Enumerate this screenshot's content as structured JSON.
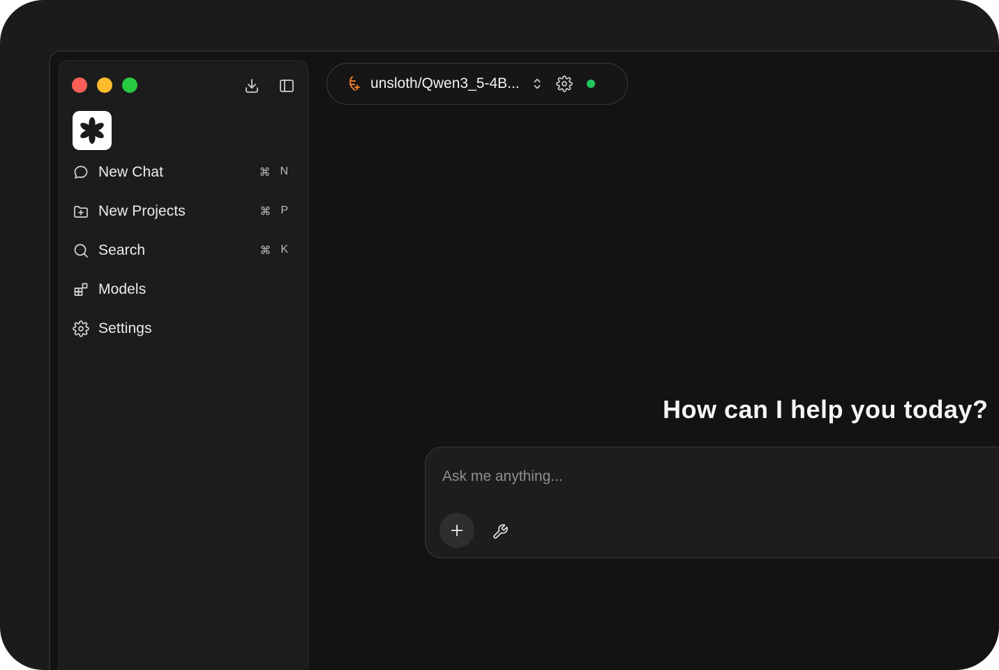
{
  "window": {
    "traffic_lights": [
      "close",
      "minimize",
      "zoom"
    ],
    "colors": {
      "close": "#ff5f57",
      "minimize": "#febc2e",
      "zoom": "#28c840"
    }
  },
  "sidebar": {
    "toolbar_icons": [
      "download-icon",
      "sidebar-toggle-icon"
    ],
    "logo_icon": "asterisk-logo",
    "items": [
      {
        "label": "New Chat",
        "icon": "chat-bubble-icon",
        "shortcut_mod": "⌘",
        "shortcut_key": "N"
      },
      {
        "label": "New Projects",
        "icon": "folder-plus-icon",
        "shortcut_mod": "⌘",
        "shortcut_key": "P"
      },
      {
        "label": "Search",
        "icon": "search-icon",
        "shortcut_mod": "⌘",
        "shortcut_key": "K"
      },
      {
        "label": "Models",
        "icon": "blocks-icon"
      },
      {
        "label": "Settings",
        "icon": "gear-icon"
      }
    ]
  },
  "header": {
    "model_name": "unsloth/Qwen3_5-4B...",
    "model_icon": "sloth-icon",
    "status": "online",
    "status_color": "#22c55e"
  },
  "main": {
    "greeting": "How can I help you today?",
    "composer": {
      "placeholder": "Ask me anything...",
      "value": ""
    }
  }
}
